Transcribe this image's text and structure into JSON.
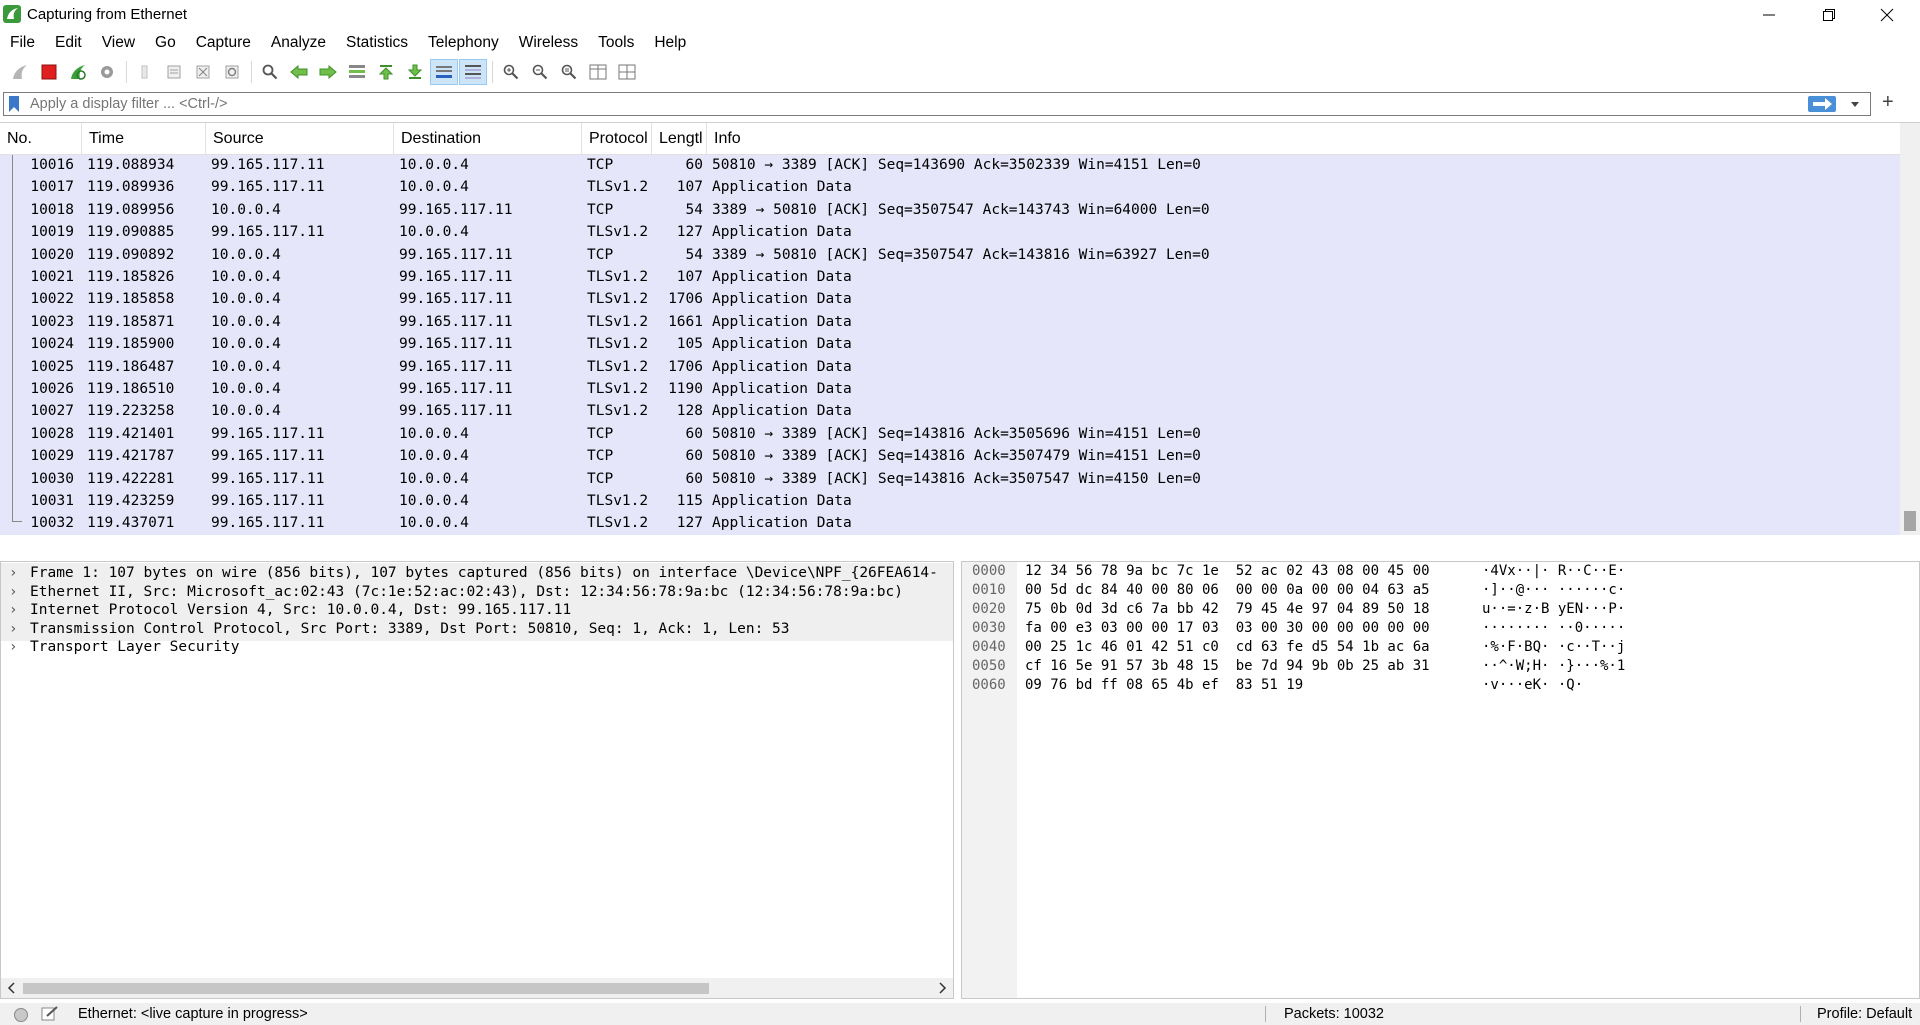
{
  "window": {
    "title": "Capturing from Ethernet"
  },
  "menu": [
    "File",
    "Edit",
    "View",
    "Go",
    "Capture",
    "Analyze",
    "Statistics",
    "Telephony",
    "Wireless",
    "Tools",
    "Help"
  ],
  "filter": {
    "placeholder": "Apply a display filter ... <Ctrl-/>",
    "plus_label": "+"
  },
  "packet_list": {
    "columns": [
      "No.",
      "Time",
      "Source",
      "Destination",
      "Protocol",
      "Lengtl",
      "Info"
    ],
    "rows": [
      {
        "no": "10016",
        "time": "119.088934",
        "src": "99.165.117.11",
        "dst": "10.0.0.4",
        "proto": "TCP",
        "len": "60",
        "info": "50810 → 3389 [ACK] Seq=143690 Ack=3502339 Win=4151 Len=0"
      },
      {
        "no": "10017",
        "time": "119.089936",
        "src": "99.165.117.11",
        "dst": "10.0.0.4",
        "proto": "TLSv1.2",
        "len": "107",
        "info": "Application Data"
      },
      {
        "no": "10018",
        "time": "119.089956",
        "src": "10.0.0.4",
        "dst": "99.165.117.11",
        "proto": "TCP",
        "len": "54",
        "info": "3389 → 50810 [ACK] Seq=3507547 Ack=143743 Win=64000 Len=0"
      },
      {
        "no": "10019",
        "time": "119.090885",
        "src": "99.165.117.11",
        "dst": "10.0.0.4",
        "proto": "TLSv1.2",
        "len": "127",
        "info": "Application Data"
      },
      {
        "no": "10020",
        "time": "119.090892",
        "src": "10.0.0.4",
        "dst": "99.165.117.11",
        "proto": "TCP",
        "len": "54",
        "info": "3389 → 50810 [ACK] Seq=3507547 Ack=143816 Win=63927 Len=0"
      },
      {
        "no": "10021",
        "time": "119.185826",
        "src": "10.0.0.4",
        "dst": "99.165.117.11",
        "proto": "TLSv1.2",
        "len": "107",
        "info": "Application Data"
      },
      {
        "no": "10022",
        "time": "119.185858",
        "src": "10.0.0.4",
        "dst": "99.165.117.11",
        "proto": "TLSv1.2",
        "len": "1706",
        "info": "Application Data"
      },
      {
        "no": "10023",
        "time": "119.185871",
        "src": "10.0.0.4",
        "dst": "99.165.117.11",
        "proto": "TLSv1.2",
        "len": "1661",
        "info": "Application Data"
      },
      {
        "no": "10024",
        "time": "119.185900",
        "src": "10.0.0.4",
        "dst": "99.165.117.11",
        "proto": "TLSv1.2",
        "len": "105",
        "info": "Application Data"
      },
      {
        "no": "10025",
        "time": "119.186487",
        "src": "10.0.0.4",
        "dst": "99.165.117.11",
        "proto": "TLSv1.2",
        "len": "1706",
        "info": "Application Data"
      },
      {
        "no": "10026",
        "time": "119.186510",
        "src": "10.0.0.4",
        "dst": "99.165.117.11",
        "proto": "TLSv1.2",
        "len": "1190",
        "info": "Application Data"
      },
      {
        "no": "10027",
        "time": "119.223258",
        "src": "10.0.0.4",
        "dst": "99.165.117.11",
        "proto": "TLSv1.2",
        "len": "128",
        "info": "Application Data"
      },
      {
        "no": "10028",
        "time": "119.421401",
        "src": "99.165.117.11",
        "dst": "10.0.0.4",
        "proto": "TCP",
        "len": "60",
        "info": "50810 → 3389 [ACK] Seq=143816 Ack=3505696 Win=4151 Len=0"
      },
      {
        "no": "10029",
        "time": "119.421787",
        "src": "99.165.117.11",
        "dst": "10.0.0.4",
        "proto": "TCP",
        "len": "60",
        "info": "50810 → 3389 [ACK] Seq=143816 Ack=3507479 Win=4151 Len=0"
      },
      {
        "no": "10030",
        "time": "119.422281",
        "src": "99.165.117.11",
        "dst": "10.0.0.4",
        "proto": "TCP",
        "len": "60",
        "info": "50810 → 3389 [ACK] Seq=143816 Ack=3507547 Win=4150 Len=0"
      },
      {
        "no": "10031",
        "time": "119.423259",
        "src": "99.165.117.11",
        "dst": "10.0.0.4",
        "proto": "TLSv1.2",
        "len": "115",
        "info": "Application Data"
      },
      {
        "no": "10032",
        "time": "119.437071",
        "src": "99.165.117.11",
        "dst": "10.0.0.4",
        "proto": "TLSv1.2",
        "len": "127",
        "info": "Application Data"
      }
    ]
  },
  "details": {
    "items": [
      "Frame 1: 107 bytes on wire (856 bits), 107 bytes captured (856 bits) on interface \\Device\\NPF_{26FEA614-",
      "Ethernet II, Src: Microsoft_ac:02:43 (7c:1e:52:ac:02:43), Dst: 12:34:56:78:9a:bc (12:34:56:78:9a:bc)",
      "Internet Protocol Version 4, Src: 10.0.0.4, Dst: 99.165.117.11",
      "Transmission Control Protocol, Src Port: 3389, Dst Port: 50810, Seq: 1, Ack: 1, Len: 53",
      "Transport Layer Security"
    ]
  },
  "bytes": {
    "rows": [
      {
        "off": "0000",
        "hex": "12 34 56 78 9a bc 7c 1e  52 ac 02 43 08 00 45 00",
        "ascii": "·4Vx··|· R··C··E·"
      },
      {
        "off": "0010",
        "hex": "00 5d dc 84 40 00 80 06  00 00 0a 00 00 04 63 a5",
        "ascii": "·]··@··· ······c·"
      },
      {
        "off": "0020",
        "hex": "75 0b 0d 3d c6 7a bb 42  79 45 4e 97 04 89 50 18",
        "ascii": "u··=·z·B yEN···P·"
      },
      {
        "off": "0030",
        "hex": "fa 00 e3 03 00 00 17 03  03 00 30 00 00 00 00 00",
        "ascii": "········ ··0·····"
      },
      {
        "off": "0040",
        "hex": "00 25 1c 46 01 42 51 c0  cd 63 fe d5 54 1b ac 6a",
        "ascii": "·%·F·BQ· ·c··T··j"
      },
      {
        "off": "0050",
        "hex": "cf 16 5e 91 57 3b 48 15  be 7d 94 9b 0b 25 ab 31",
        "ascii": "··^·W;H· ·}···%·1"
      },
      {
        "off": "0060",
        "hex": "09 76 bd ff 08 65 4b ef  83 51 19",
        "ascii": "·v···eK· ·Q·"
      }
    ]
  },
  "status": {
    "capture": "Ethernet: <live capture in progress>",
    "packets": "Packets: 10032",
    "profile": "Profile: Default"
  },
  "colors": {
    "row_bg": "#e6e6fa",
    "accent": "#4a90d9"
  }
}
